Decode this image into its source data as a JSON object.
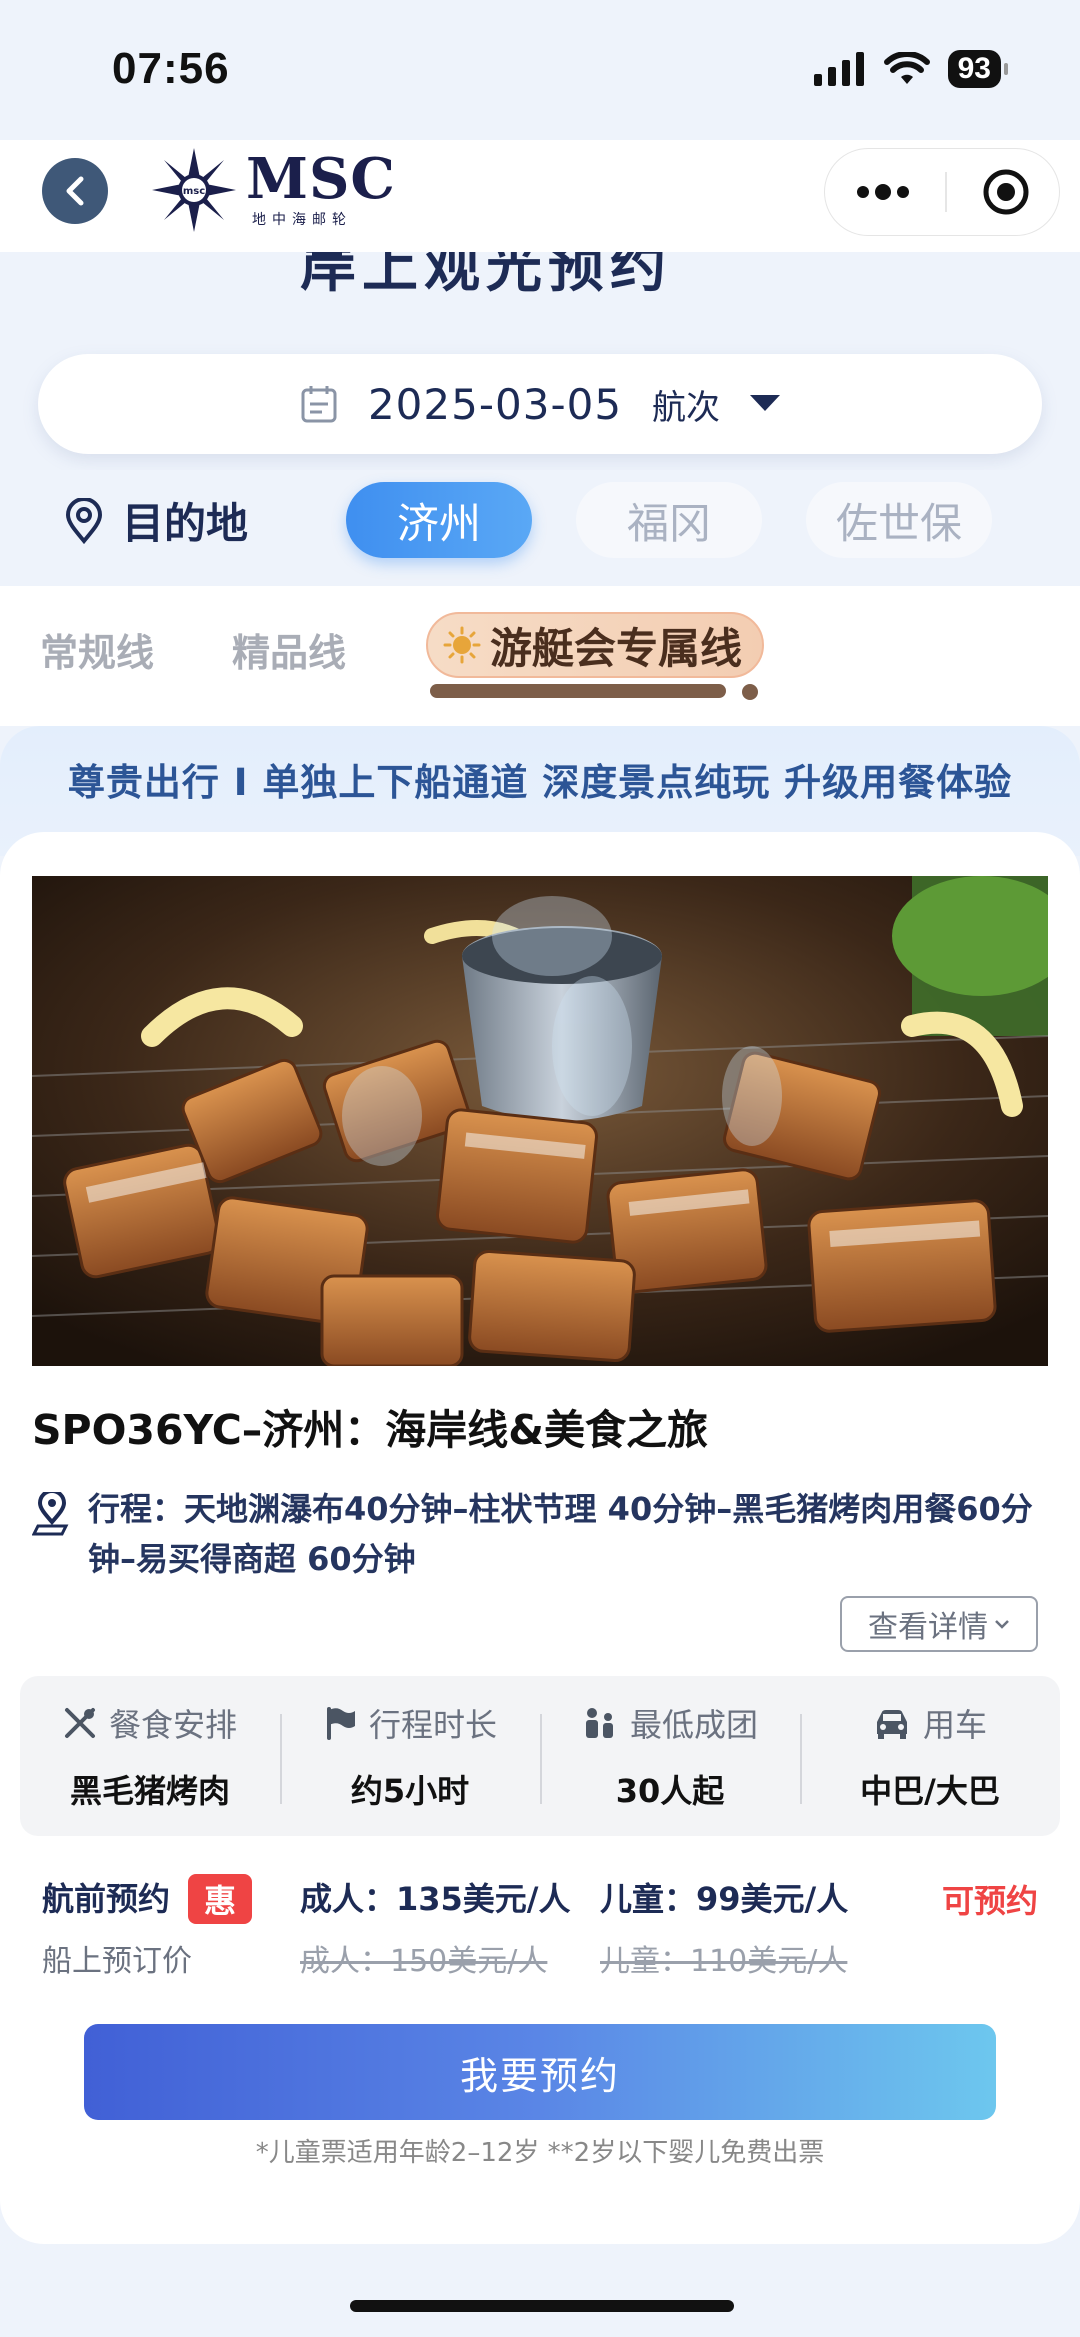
{
  "status_bar": {
    "time": "07:56",
    "battery": "93"
  },
  "header": {
    "logo_text": "MSC",
    "logo_subtitle": "地中海邮轮"
  },
  "page": {
    "title": "岸上观光预约"
  },
  "date_selector": {
    "date": "2025-03-05",
    "voyage_label": "航次"
  },
  "destination": {
    "label": "目的地",
    "ports": [
      "济州",
      "福冈",
      "佐世保"
    ],
    "selected": "济州"
  },
  "line_tabs": {
    "tabs": [
      "常规线",
      "精品线",
      "游艇会专属线"
    ],
    "active": "游艇会专属线"
  },
  "banner": {
    "text": "尊贵出行 I 单独上下船通道 深度景点纯玩 升级用餐体验"
  },
  "product": {
    "title": "SPO36YC–济州：海岸线&美食之旅",
    "route": "行程：天地渊瀑布40分钟–柱状节理 40分钟–黑毛猪烤肉用餐60分钟–易买得商超 60分钟",
    "detail_button": "查看详情",
    "info": [
      {
        "label": "餐食安排",
        "value": "黑毛猪烤肉",
        "icon": "utensils-icon"
      },
      {
        "label": "行程时长",
        "value": "约5小时",
        "icon": "flag-icon"
      },
      {
        "label": "最低成团",
        "value": "30人起",
        "icon": "people-icon"
      },
      {
        "label": "用车",
        "value": "中巴/大巴",
        "icon": "car-icon"
      }
    ]
  },
  "pricing": {
    "pre_booking_label": "航前预约",
    "discount_badge": "惠",
    "adult_price": "成人：135美元/人",
    "child_price": "儿童：99美元/人",
    "status": "可预约",
    "onboard_label": "船上预订价",
    "adult_price_onboard": "成人：150美元/人",
    "child_price_onboard": "儿童：110美元/人"
  },
  "booking": {
    "button_label": "我要预约",
    "note": "*儿童票适用年龄2–12岁 **2岁以下婴儿免费出票"
  },
  "colors": {
    "accent": "#3f8ff0",
    "badge": "#ef4444",
    "brand_navy": "#1b1f4b"
  }
}
